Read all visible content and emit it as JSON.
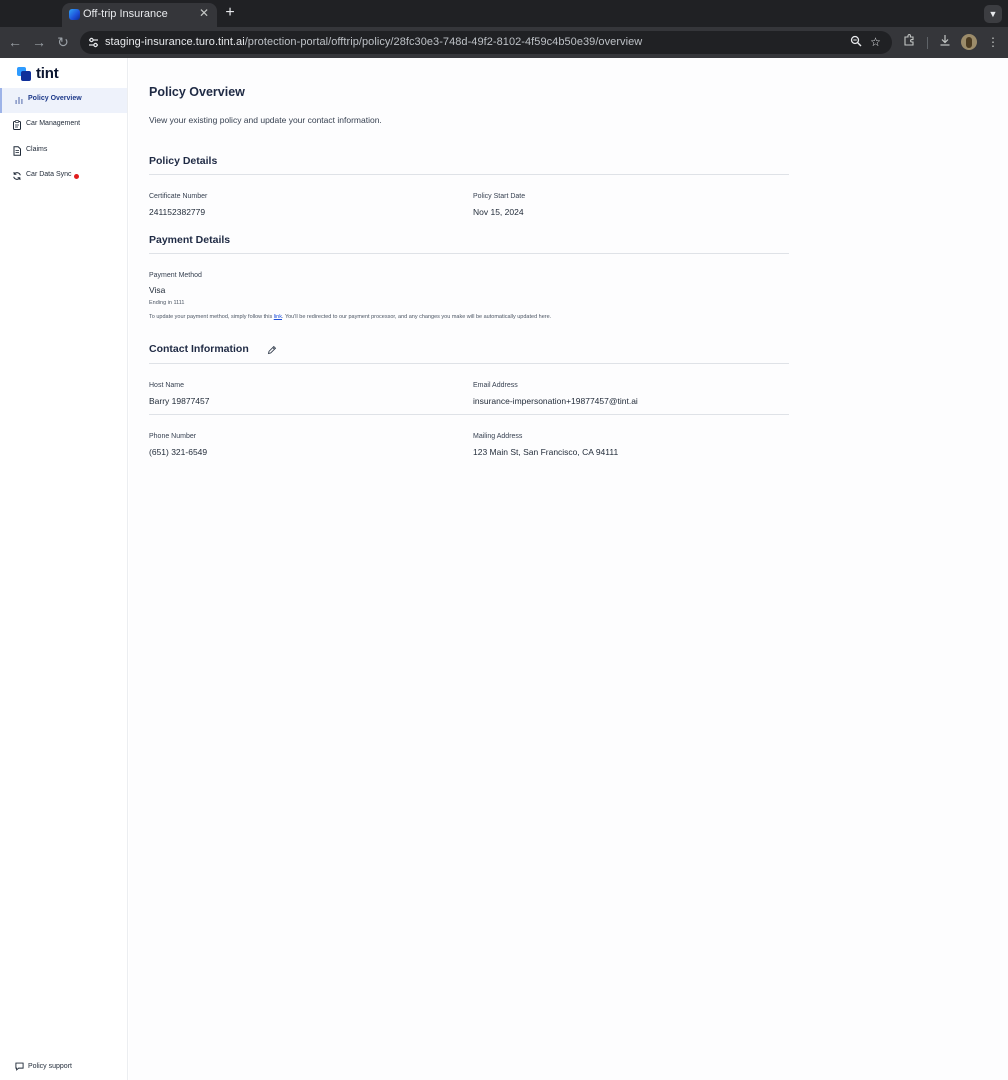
{
  "browser": {
    "tab_title": "Off-trip Insurance",
    "url_host": "staging-insurance.turo.tint.ai",
    "url_path": "/protection-portal/offtrip/policy/28fc30e3-748d-49f2-8102-4f59c4b50e39/overview"
  },
  "sidebar": {
    "logo_text": "tint",
    "items": [
      {
        "label": "Policy Overview",
        "icon": "bar-chart-icon",
        "active": true
      },
      {
        "label": "Car Management",
        "icon": "clipboard-icon",
        "active": false
      },
      {
        "label": "Claims",
        "icon": "document-icon",
        "active": false
      },
      {
        "label": "Car Data Sync",
        "icon": "sync-icon",
        "active": false,
        "alert": true
      }
    ],
    "support_label": "Policy support",
    "alert_color": "#e11d1d"
  },
  "main": {
    "title": "Policy Overview",
    "subtitle": "View your existing policy and update your contact information.",
    "policy_details": {
      "heading": "Policy Details",
      "certificate_label": "Certificate Number",
      "certificate_value": "241152382779",
      "start_label": "Policy Start Date",
      "start_value": "Nov 15, 2024"
    },
    "payment_details": {
      "heading": "Payment Details",
      "method_label": "Payment Method",
      "method_value": "Visa",
      "ending": "Ending in 1111",
      "note_before": "To update your payment method, simply follow this ",
      "note_link": "link",
      "note_after": ". You'll be redirected to our payment processor, and any changes you make will be automatically updated here."
    },
    "contact_information": {
      "heading": "Contact Information",
      "host_label": "Host Name",
      "host_value": "Barry 19877457",
      "email_label": "Email Address",
      "email_value": "insurance-impersonation+19877457@tint.ai",
      "phone_label": "Phone Number",
      "phone_value": "(651) 321-6549",
      "mailing_label": "Mailing Address",
      "mailing_value": "123 Main St, San Francisco, CA 94111"
    }
  }
}
